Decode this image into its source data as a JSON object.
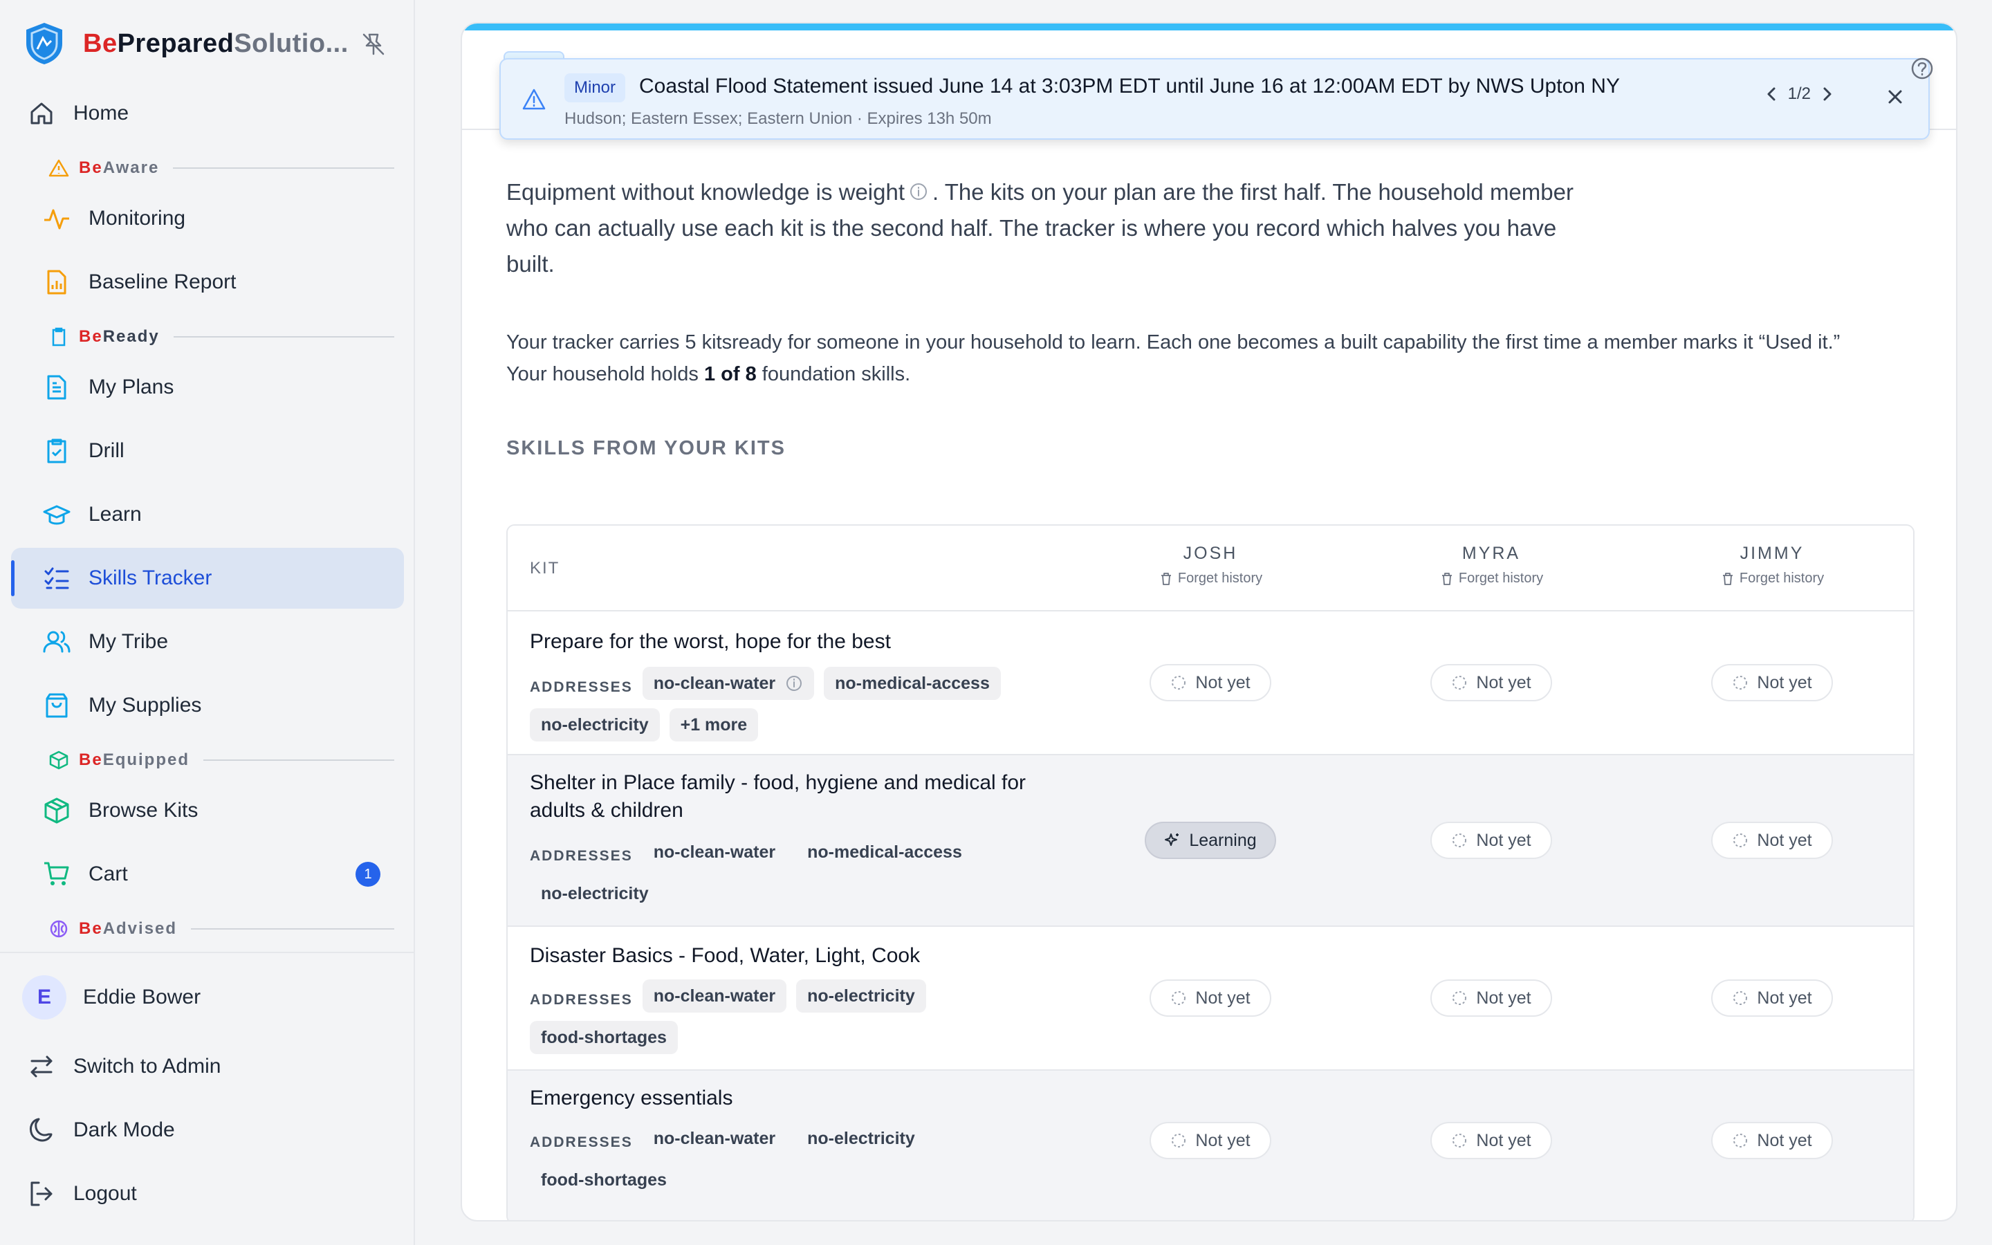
{
  "brand": {
    "be": "Be",
    "prepared": "Prepared",
    "solutions": "Solutio..."
  },
  "nav": {
    "home": "Home",
    "sections": {
      "aware": {
        "be": "Be",
        "rest": "Aware"
      },
      "ready": {
        "be": "Be",
        "rest": "Ready"
      },
      "equipped": {
        "be": "Be",
        "rest": "Equipped"
      },
      "advised": {
        "be": "Be",
        "rest": "Advised"
      }
    },
    "items": {
      "monitoring": "Monitoring",
      "baseline_report": "Baseline Report",
      "my_plans": "My Plans",
      "drill": "Drill",
      "learn": "Learn",
      "skills_tracker": "Skills Tracker",
      "my_tribe": "My Tribe",
      "my_supplies": "My Supplies",
      "browse_kits": "Browse Kits",
      "cart": "Cart"
    },
    "cart_count": "1"
  },
  "user": {
    "initial": "E",
    "name": "Eddie Bower"
  },
  "bottom": {
    "switch_admin": "Switch to Admin",
    "dark_mode": "Dark Mode",
    "logout": "Logout"
  },
  "alert": {
    "severity": "Minor",
    "title": "Coastal Flood Statement issued June 14 at 3:03PM EDT until June 16 at 12:00AM EDT by NWS Upton NY",
    "subtitle": "Hudson; Eastern Essex; Eastern Union · Expires 13h 50m",
    "pager": "1/2"
  },
  "intro": {
    "part1": "Equipment without knowledge is weight",
    "part2": ". The kits on your plan are the first half. The household member who can actually use each kit is the second half. The tracker is where you record which halves you have built."
  },
  "summary": {
    "line1": "Your tracker carries 5 kitsready for someone in your household to learn. Each one becomes a built capability the first time a member marks it “Used it.”",
    "line2_pre": "Your household holds",
    "line2_bold": "1 of 8",
    "line2_post": "foundation skills."
  },
  "skills_heading": "SKILLS FROM YOUR KITS",
  "table": {
    "kit_header": "KIT",
    "members": [
      {
        "name": "JOSH",
        "forget": "Forget history"
      },
      {
        "name": "MYRA",
        "forget": "Forget history"
      },
      {
        "name": "JIMMY",
        "forget": "Forget history"
      }
    ],
    "addresses_label": "ADDRESSES",
    "rows": [
      {
        "name": "Prepare for the worst, hope for the best",
        "tags": [
          "no-clean-water",
          "no-medical-access",
          "no-electricity",
          "+1 more"
        ],
        "status": [
          "Not yet",
          "Not yet",
          "Not yet"
        ]
      },
      {
        "name": "Shelter in Place family - food, hygiene and medical for adults & children",
        "tags": [
          "no-clean-water",
          "no-medical-access",
          "no-electricity"
        ],
        "status": [
          "Learning",
          "Not yet",
          "Not yet"
        ]
      },
      {
        "name": "Disaster Basics - Food, Water, Light, Cook",
        "tags": [
          "no-clean-water",
          "no-electricity",
          "food-shortages"
        ],
        "status": [
          "Not yet",
          "Not yet",
          "Not yet"
        ]
      },
      {
        "name": "Emergency essentials",
        "tags": [
          "no-clean-water",
          "no-electricity",
          "food-shortages"
        ],
        "status": [
          "Not yet",
          "Not yet",
          "Not yet"
        ]
      }
    ]
  },
  "colors": {
    "accent": "#2563eb",
    "brand_red": "#dc2626",
    "alert_bar": "#38bdf8",
    "aware": "#f59e0b",
    "ready": "#0ea5e9",
    "equipped": "#10b981",
    "advised": "#8b5cf6"
  },
  "icons": [
    "shield-logo-icon",
    "pin-off-icon",
    "home-icon",
    "alert-triangle-icon",
    "activity-icon",
    "report-icon",
    "clipboard-icon",
    "file-text-icon",
    "clipboard-check-icon",
    "graduation-cap-icon",
    "list-checks-icon",
    "users-icon",
    "shopping-bag-icon",
    "box-icon",
    "cart-icon",
    "brain-icon",
    "switch-icon",
    "moon-icon",
    "logout-icon",
    "info-icon",
    "help-icon",
    "chevron-left-icon",
    "chevron-right-icon",
    "close-icon",
    "trash-icon",
    "loader-icon",
    "sparkles-icon"
  ]
}
